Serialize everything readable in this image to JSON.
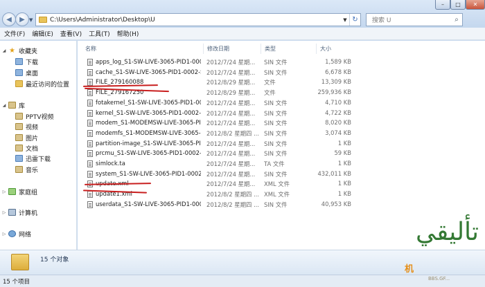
{
  "address": {
    "path": "C:\\Users\\Administrator\\Desktop\\U",
    "search_placeholder": "搜索 U"
  },
  "menu": [
    "文件(F)",
    "编辑(E)",
    "查看(V)",
    "工具(T)",
    "帮助(H)"
  ],
  "nav": {
    "favorites": "收藏夹",
    "favorites_items": [
      "下载",
      "桌面",
      "最近访问的位置"
    ],
    "libraries": "库",
    "library_items": [
      "PPTV视频",
      "视频",
      "图片",
      "文档",
      "迅雷下载",
      "音乐"
    ],
    "homegroup": "家庭组",
    "computer": "计算机",
    "network": "网络"
  },
  "columns": {
    "name": "名称",
    "date": "修改日期",
    "type": "类型",
    "size": "大小"
  },
  "files": [
    {
      "name": "apps_log_S1-SW-LIVE-3065-PID1-000...",
      "date": "2012/7/24 星期...",
      "type": "SIN 文件",
      "size": "1,589 KB"
    },
    {
      "name": "cache_S1-SW-LIVE-3065-PID1-0002-S...",
      "date": "2012/7/24 星期...",
      "type": "SIN 文件",
      "size": "6,678 KB"
    },
    {
      "name": "FILE_279160088",
      "date": "2012/8/29 星期...",
      "type": "文件",
      "size": "13,309 KB"
    },
    {
      "name": "FILE_279167250",
      "date": "2012/8/29 星期...",
      "type": "文件",
      "size": "259,936 KB"
    },
    {
      "name": "fotakernel_S1-SW-LIVE-3065-PID1-00...",
      "date": "2012/7/24 星期...",
      "type": "SIN 文件",
      "size": "4,710 KB"
    },
    {
      "name": "kernel_S1-SW-LIVE-3065-PID1-0002-...",
      "date": "2012/7/24 星期...",
      "type": "SIN 文件",
      "size": "4,722 KB"
    },
    {
      "name": "modem_S1-MODEMSW-LIVE-3065-PI...",
      "date": "2012/7/24 星期...",
      "type": "SIN 文件",
      "size": "8,020 KB"
    },
    {
      "name": "modemfs_S1-MODEMSW-LIVE-3065-...",
      "date": "2012/8/2 星期四 ...",
      "type": "SIN 文件",
      "size": "3,074 KB"
    },
    {
      "name": "partition-image_S1-SW-LIVE-3065-PI...",
      "date": "2012/7/24 星期...",
      "type": "SIN 文件",
      "size": "1 KB"
    },
    {
      "name": "prcmu_S1-SW-LIVE-3065-PID1-0002-...",
      "date": "2012/7/24 星期...",
      "type": "SIN 文件",
      "size": "59 KB"
    },
    {
      "name": "simlock.ta",
      "date": "2012/7/24 星期...",
      "type": "TA 文件",
      "size": "1 KB"
    },
    {
      "name": "system_S1-SW-LIVE-3065-PID1-0002-...",
      "date": "2012/7/24 星期...",
      "type": "SIN 文件",
      "size": "432,011 KB"
    },
    {
      "name": "update.xml",
      "date": "2012/7/24 星期...",
      "type": "XML 文件",
      "size": "1 KB"
    },
    {
      "name": "update1.xml",
      "date": "2012/8/2 星期四 ...",
      "type": "XML 文件",
      "size": "1 KB"
    },
    {
      "name": "userdata_S1-SW-LIVE-3065-PID1-000...",
      "date": "2012/8/2 星期四 ...",
      "type": "SIN 文件",
      "size": "40,953 KB"
    }
  ],
  "details": {
    "count": "15 个对象"
  },
  "status": {
    "text": "15 个项目"
  },
  "watermark": {
    "text": "تأليقي",
    "brand": "机",
    "url": "BBS.GF..."
  },
  "colors": {
    "annotation": "#c81e1e",
    "chrome": "#c9dbef"
  }
}
